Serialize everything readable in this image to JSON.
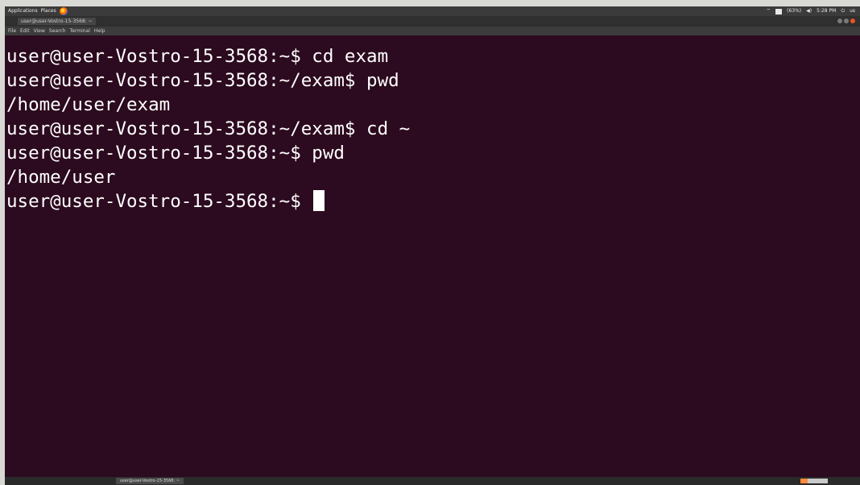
{
  "top_panel": {
    "applications": "Applications",
    "places": "Places",
    "tray_text_1": "(63%)",
    "tray_text_2": "5:28 PM",
    "user": "us"
  },
  "window": {
    "title": "user@user-Vostro-15-3568: ~"
  },
  "menu": [
    "File",
    "Edit",
    "View",
    "Search",
    "Terminal",
    "Help"
  ],
  "terminal": {
    "lines": [
      "user@user-Vostro-15-3568:~$ cd exam",
      "user@user-Vostro-15-3568:~/exam$ pwd",
      "/home/user/exam",
      "user@user-Vostro-15-3568:~/exam$ cd ~",
      "user@user-Vostro-15-3568:~$ pwd",
      "/home/user",
      "user@user-Vostro-15-3568:~$ "
    ]
  },
  "taskbar": {
    "item": "user@user-Vostro-15-3568: ~"
  },
  "colors": {
    "terminal_bg": "#2c0a1f",
    "text": "#ffffff",
    "accent": "#e95420"
  }
}
